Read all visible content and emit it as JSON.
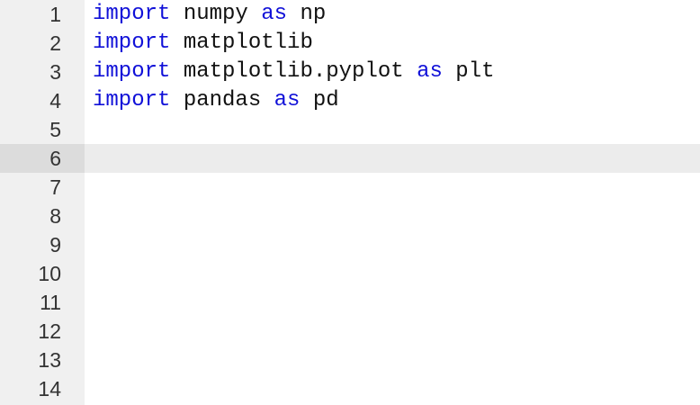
{
  "editor": {
    "active_line": 6,
    "lines": [
      {
        "number": "1",
        "tokens": [
          {
            "text": "import",
            "kw": true
          },
          {
            "text": " numpy ",
            "kw": false
          },
          {
            "text": "as",
            "kw": true
          },
          {
            "text": " np",
            "kw": false
          }
        ]
      },
      {
        "number": "2",
        "tokens": [
          {
            "text": "import",
            "kw": true
          },
          {
            "text": " matplotlib",
            "kw": false
          }
        ]
      },
      {
        "number": "3",
        "tokens": [
          {
            "text": "import",
            "kw": true
          },
          {
            "text": " matplotlib.pyplot ",
            "kw": false
          },
          {
            "text": "as",
            "kw": true
          },
          {
            "text": " plt",
            "kw": false
          }
        ]
      },
      {
        "number": "4",
        "tokens": [
          {
            "text": "import",
            "kw": true
          },
          {
            "text": " pandas ",
            "kw": false
          },
          {
            "text": "as",
            "kw": true
          },
          {
            "text": " pd",
            "kw": false
          }
        ]
      },
      {
        "number": "5",
        "tokens": []
      },
      {
        "number": "6",
        "tokens": []
      },
      {
        "number": "7",
        "tokens": []
      },
      {
        "number": "8",
        "tokens": []
      },
      {
        "number": "9",
        "tokens": []
      },
      {
        "number": "10",
        "tokens": []
      },
      {
        "number": "11",
        "tokens": []
      },
      {
        "number": "12",
        "tokens": []
      },
      {
        "number": "13",
        "tokens": []
      },
      {
        "number": "14",
        "tokens": []
      }
    ]
  },
  "colors": {
    "keyword": "#1010d8",
    "gutter_background": "#f0f0f0",
    "active_line_background": "#ececec"
  }
}
